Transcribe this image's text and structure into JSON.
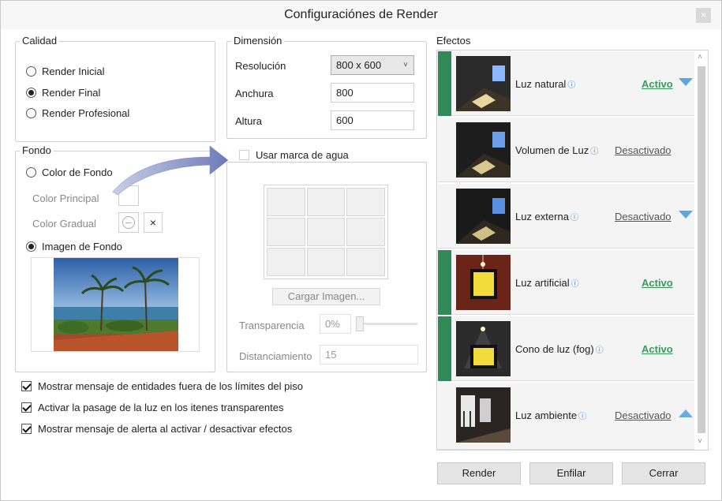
{
  "window": {
    "title": "Configuraciónes de Render",
    "close_label": "×"
  },
  "quality": {
    "legend": "Calidad",
    "options": [
      {
        "label": "Render Inicial",
        "selected": false
      },
      {
        "label": "Render Final",
        "selected": true
      },
      {
        "label": "Render Profesional",
        "selected": false
      }
    ]
  },
  "dimension": {
    "legend": "Dimensión",
    "resolution_label": "Resolución",
    "resolution_value": "800 x 600",
    "width_label": "Anchura",
    "width_value": "800",
    "height_label": "Altura",
    "height_value": "600"
  },
  "background": {
    "legend": "Fondo",
    "color_option": "Color de Fondo",
    "primary_color_label": "Color Principal",
    "gradient_color_label": "Color Gradual",
    "clear_label": "×",
    "image_option": "Imagen de Fondo"
  },
  "watermark": {
    "label": "Usar marca de agua",
    "load_button": "Cargar Imagen...",
    "transparency_label": "Transparencia",
    "transparency_value": "0%",
    "transparency_level": 0,
    "distance_label": "Distanciamiento",
    "distance_value": "15"
  },
  "options": [
    "Mostrar mensaje de entidades fuera de los límites del piso",
    "Activar la pasage de la luz en los itenes transparentes",
    "Mostrar mensaje de alerta al activar / desactivar efectos"
  ],
  "effects": {
    "label": "Efectos",
    "info_glyph": "ⓘ",
    "items": [
      {
        "name": "Luz natural",
        "status": "Activo",
        "active": true,
        "arrow": "down"
      },
      {
        "name": "Volumen de Luz",
        "status": "Desactivado",
        "active": false,
        "arrow": ""
      },
      {
        "name": "Luz externa",
        "status": "Desactivado",
        "active": false,
        "arrow": "down"
      },
      {
        "name": "Luz artificial",
        "status": "Activo",
        "active": true,
        "arrow": ""
      },
      {
        "name": "Cono de luz (fog)",
        "status": "Activo",
        "active": true,
        "arrow": ""
      },
      {
        "name": "Luz ambiente",
        "status": "Desactivado",
        "active": false,
        "arrow": "up"
      }
    ]
  },
  "buttons": {
    "render": "Render",
    "queue": "Enfilar",
    "close": "Cerrar"
  },
  "colors": {
    "active_bar": "#2f8a57",
    "active_text": "#3a9a5a",
    "arrow": "#5aa8df"
  }
}
